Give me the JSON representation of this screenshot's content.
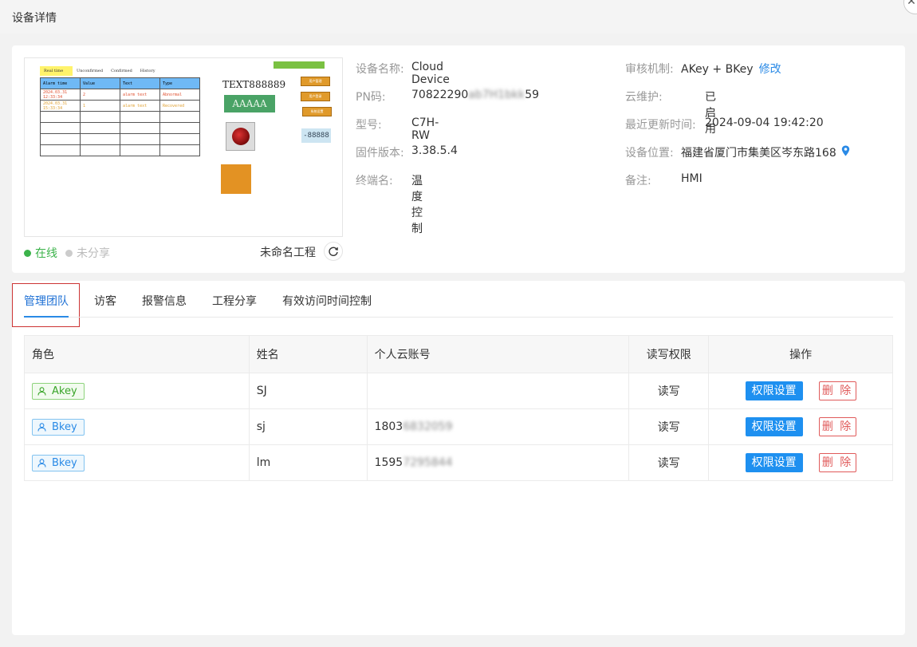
{
  "modal": {
    "title": "设备详情",
    "close_glyph": "✕"
  },
  "preview": {
    "hmi_tabs": [
      "Real time",
      "Unconfirmed",
      "Confirmed",
      "History"
    ],
    "hmi_table_header": [
      "Alarm time",
      "Value",
      "Text",
      "Type"
    ],
    "hmi_rows": [
      [
        "2024.03.31 12:33:34",
        "2",
        "alarm text",
        "Abnormal"
      ],
      [
        "2024.03.31 15:33:34",
        "1",
        "alarm text",
        "Recovered"
      ]
    ],
    "hmi_text": "TEXT888889",
    "hmi_green_label": "AAAAA",
    "hmi_buttons": [
      "用户管理",
      "用户登录",
      "系统设置"
    ],
    "hmi_number": "-88888",
    "online_label": "在线",
    "unshared_label": "未分享",
    "project_name": "未命名工程"
  },
  "info": {
    "device_name": {
      "label": "设备名称:",
      "value": "Cloud Device"
    },
    "pn": {
      "label": "PN码:",
      "value_prefix": "70822290",
      "value_masked": "ab7H1bkk",
      "value_suffix": "59"
    },
    "model": {
      "label": "型号:",
      "value": "C7H-RW"
    },
    "firmware": {
      "label": "固件版本:",
      "value": "3.38.5.4"
    },
    "terminal": {
      "label": "终端名:",
      "value": "温度控制"
    },
    "audit": {
      "label": "审核机制:",
      "value": "AKey + BKey",
      "edit": "修改"
    },
    "cloud_maint": {
      "label": "云维护:",
      "value": "已启用"
    },
    "last_update": {
      "label": "最近更新时间:",
      "value": "2024-09-04 19:42:20"
    },
    "location": {
      "label": "设备位置:",
      "value": "福建省厦门市集美区岑东路168"
    },
    "remark": {
      "label": "备注:",
      "value": "HMI"
    }
  },
  "tabs": [
    "管理团队",
    "访客",
    "报警信息",
    "工程分享",
    "有效访问时间控制"
  ],
  "table": {
    "headers": [
      "角色",
      "姓名",
      "个人云账号",
      "读写权限",
      "操作"
    ],
    "rows": [
      {
        "role": "Akey",
        "name": "SJ",
        "account": "",
        "account_masked": "",
        "perm": "读写"
      },
      {
        "role": "Bkey",
        "name": "sj",
        "account": "1803",
        "account_masked": "6832059",
        "perm": "读写"
      },
      {
        "role": "Bkey",
        "name": "lm",
        "account": "1595",
        "account_masked": "7295844",
        "perm": "读写"
      }
    ],
    "perm_button": "权限设置",
    "delete_button": "删 除"
  },
  "colors": {
    "accent": "#1e90f0",
    "online": "#3bb34a",
    "danger": "#e05a5a",
    "akey": "#3aa52a",
    "bkey": "#2a8ae6"
  }
}
